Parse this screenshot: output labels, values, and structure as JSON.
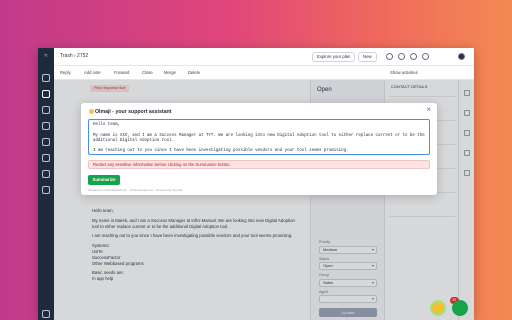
{
  "header": {
    "breadcrumb": "Trash  ›  2752",
    "explore_plan": "Explore your plan",
    "new_label": "New"
  },
  "toolbar": {
    "items": [
      "Reply",
      "Add note",
      "Forward",
      "Close",
      "Merge",
      "Delete"
    ],
    "show_activities": "Show activities"
  },
  "ticket": {
    "tag": "First response due",
    "status": "Open",
    "email_paragraphs": [
      "Hello team,",
      "My name is Marek, and I am a Success Manager at Infini Manual. We are looking into new Digital Adoption tool to either replace current or to be the additional Digital Adoption tool.",
      "I am reaching out to you since I have been investigating possible vendors and your tool seems promising.",
      "Systems:\nUsiTe\nSuccessFactor\nOther Webbased programs",
      "Basic needs are:\nIn app help"
    ]
  },
  "properties": {
    "priority_label": "Priority",
    "priority_value": "Medium",
    "status_label": "Status",
    "status_value": "Open",
    "group_label": "Group",
    "group_value": "Sales",
    "agent_label": "Agent",
    "update_button": "Update"
  },
  "contact": {
    "header": "CONTACT DETAILS"
  },
  "modal": {
    "title": "Olmaji - your support assistant",
    "textarea": "Hello team,\n\nMy name is XXX, and I am a Success Manager at TYT. We are looking into new Digital Adoption tool to either replace current or to be the\nadditional Digital Adoption tool.\n\nI am reaching out to you since I have been investigating possible vendors and your tool seems promising.",
    "warning": "Redact any sensitive information before clicking on the Summarize button.",
    "summarize_button": "Summarize",
    "footer": "Created by Infinit Manual Ltd. · infinitmanual.com · powered by OpenAI"
  },
  "widgets": {
    "badge_count": "87"
  }
}
